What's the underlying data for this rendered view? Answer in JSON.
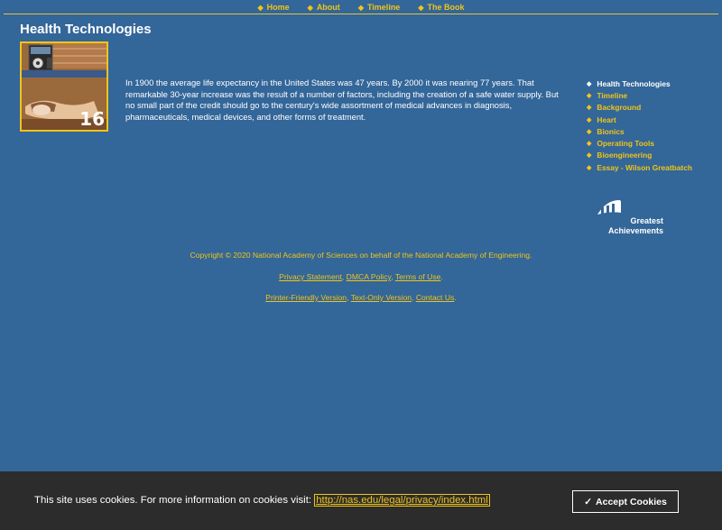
{
  "top_nav": [
    {
      "label": "Home"
    },
    {
      "label": "About"
    },
    {
      "label": "Timeline"
    },
    {
      "label": "The Book"
    }
  ],
  "page_title": "Health Technologies",
  "hero_number": "16",
  "intro": "In 1900 the average life expectancy in the United States was 47 years. By 2000 it was nearing 77 years. That remarkable 30-year increase was the result of a number of factors, including the creation of a safe water supply. But no small part of the credit should go to the century's wide assortment of medical advances in diagnosis, pharmaceuticals, medical devices, and other forms of treatment.",
  "side_nav": [
    {
      "label": "Health Technologies"
    },
    {
      "label": "Timeline"
    },
    {
      "label": "Background"
    },
    {
      "label": "Heart"
    },
    {
      "label": "Bionics"
    },
    {
      "label": "Operating Tools"
    },
    {
      "label": "Bioengineering"
    },
    {
      "label": "Essay - Wilson Greatbatch"
    }
  ],
  "logo": {
    "line1": "Greatest",
    "line2": "Achievements"
  },
  "footer": {
    "copyright": "Copyright © 2020 National Academy of Sciences on behalf of the National Academy of Engineering.",
    "privacy": "Privacy Statement",
    "dmca": "DMCA Policy",
    "terms": "Terms of Use",
    "printer": "Printer-Friendly Version",
    "text_only": "Text-Only Version",
    "contact": "Contact Us"
  },
  "cookie": {
    "message": "This site uses cookies. For more information on cookies visit:",
    "link": "http://nas.edu/legal/privacy/index.html",
    "button": "Accept Cookies"
  },
  "colors": {
    "background": "#336699",
    "accent": "#f0c419",
    "cookie_bar": "#2c2c2c"
  }
}
